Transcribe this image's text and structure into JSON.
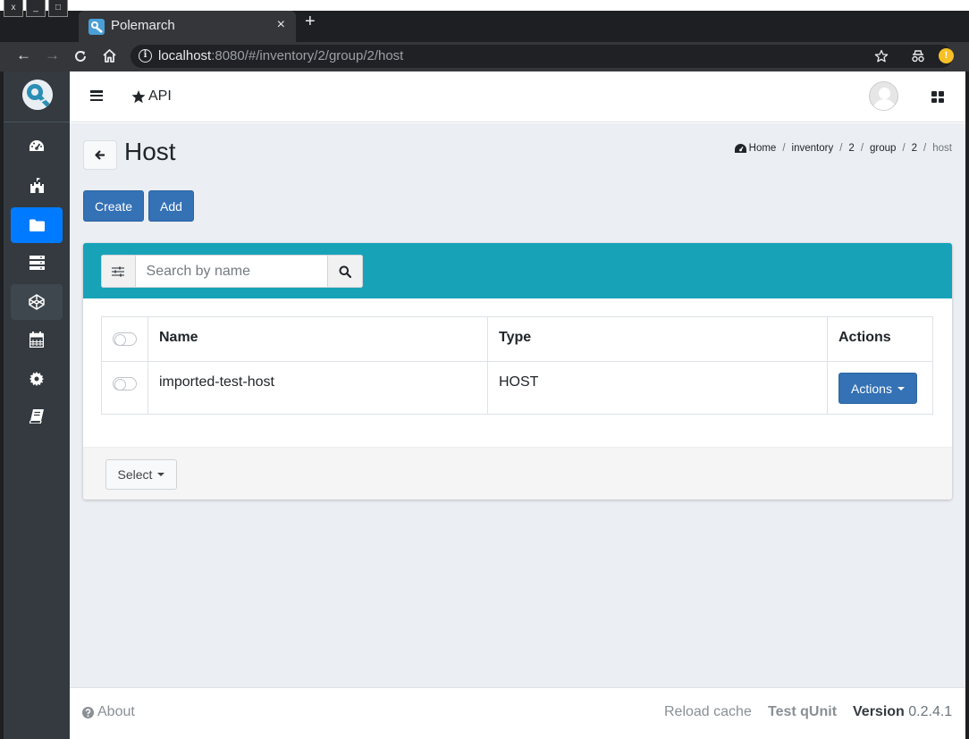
{
  "browser": {
    "window_buttons": [
      "x",
      "_",
      "□"
    ],
    "tab_title": "Polemarch",
    "tab_close": "×",
    "new_tab": "+",
    "url_host": "localhost",
    "url_rest": ":8080/#/inventory/2/group/2/host"
  },
  "navbar": {
    "api_label": "API"
  },
  "page": {
    "title": "Host",
    "breadcrumb": {
      "home": "Home",
      "items": [
        "inventory",
        "2",
        "group",
        "2"
      ],
      "current": "host",
      "separator": "/"
    },
    "buttons": {
      "create": "Create",
      "add": "Add"
    },
    "search": {
      "placeholder": "Search by name"
    },
    "table": {
      "headers": [
        "Name",
        "Type",
        "Actions"
      ],
      "rows": [
        {
          "name": "imported-test-host",
          "type": "HOST",
          "actions_label": "Actions"
        }
      ]
    },
    "select_label": "Select"
  },
  "footer": {
    "about": "About",
    "reload_cache": "Reload cache",
    "test_qunit": "Test qUnit",
    "version_label": "Version",
    "version_number": "0.2.4.1"
  },
  "sidebar": {
    "items": [
      {
        "icon": "dashboard-icon",
        "active": false
      },
      {
        "icon": "castle-icon",
        "active": false
      },
      {
        "icon": "folder-icon",
        "active": true
      },
      {
        "icon": "server-icon",
        "active": false
      },
      {
        "icon": "codepen-icon",
        "active": false
      },
      {
        "icon": "calendar-icon",
        "active": false
      },
      {
        "icon": "gear-icon",
        "active": false
      },
      {
        "icon": "book-icon",
        "active": false
      }
    ]
  },
  "colors": {
    "primary": "#3471b5",
    "sidebar_active": "#007bff",
    "sidebar_bg": "#343a40",
    "card_header": "#17a2b8",
    "content_bg": "#ebeef3"
  }
}
